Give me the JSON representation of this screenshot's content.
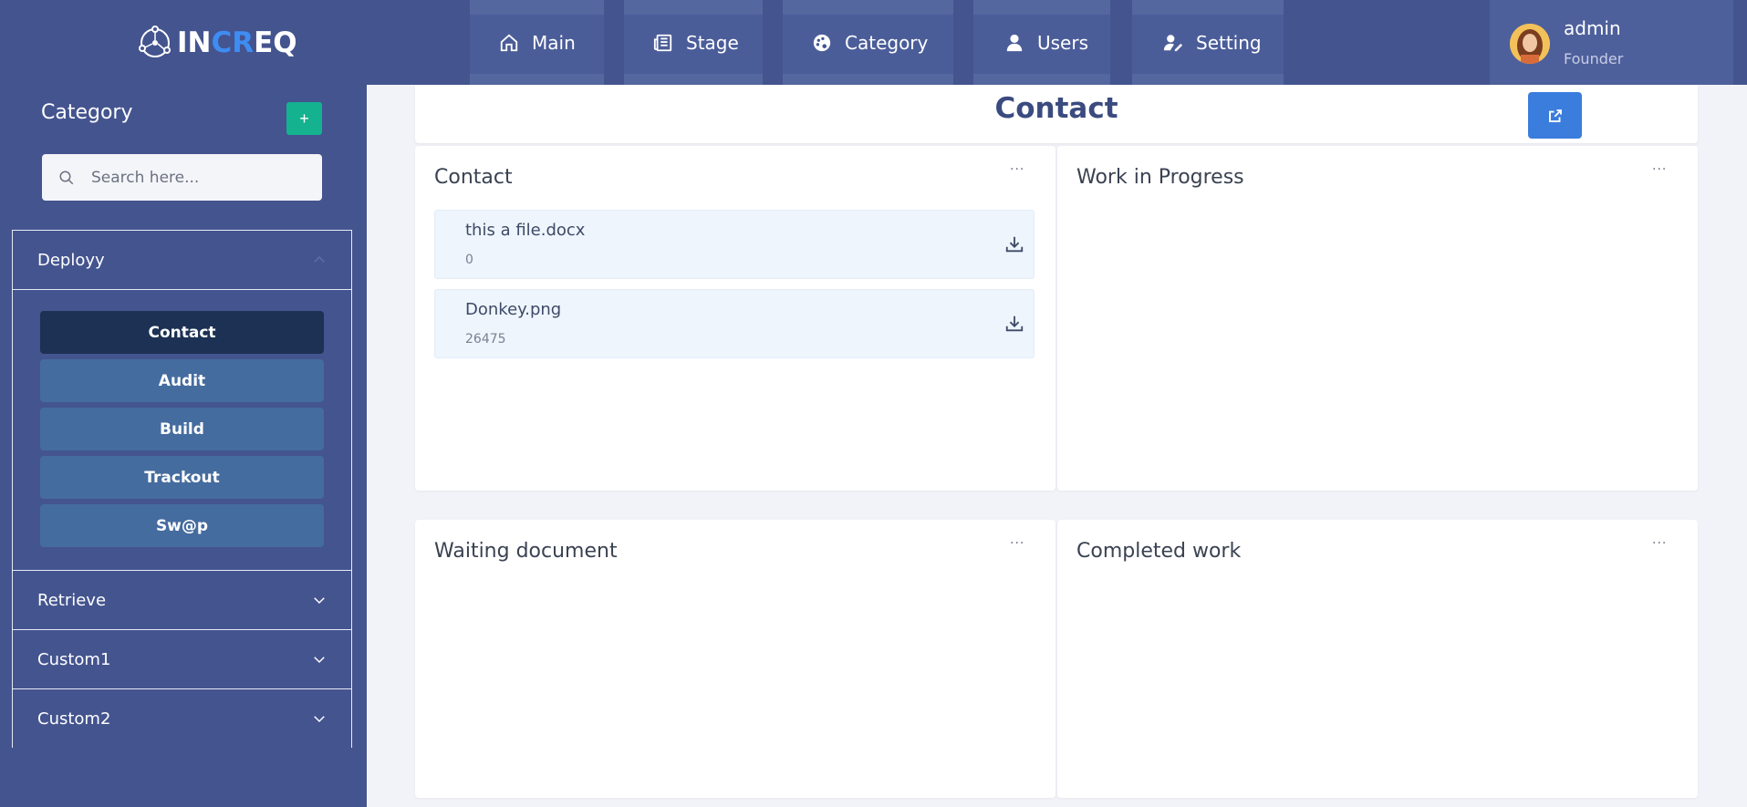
{
  "brand": {
    "name_prefix": "IN",
    "name_accent": "CR",
    "name_suffix": "EQ"
  },
  "nav": {
    "items": [
      {
        "label": "Main",
        "icon": "home-icon"
      },
      {
        "label": "Stage",
        "icon": "newspaper-icon"
      },
      {
        "label": "Category",
        "icon": "palette-icon"
      },
      {
        "label": "Users",
        "icon": "user-icon"
      },
      {
        "label": "Setting",
        "icon": "user-edit-icon"
      }
    ]
  },
  "user": {
    "name": "admin",
    "role": "Founder"
  },
  "sidebar": {
    "title": "Category",
    "add_label": "+",
    "search_placeholder": "Search here...",
    "sections": [
      {
        "label": "Deployy",
        "expanded": true,
        "items": [
          {
            "label": "Contact",
            "active": true
          },
          {
            "label": "Audit",
            "active": false
          },
          {
            "label": "Build",
            "active": false
          },
          {
            "label": "Trackout",
            "active": false
          },
          {
            "label": "Sw@p",
            "active": false
          }
        ]
      },
      {
        "label": "Retrieve",
        "expanded": false
      },
      {
        "label": "Custom1",
        "expanded": false
      },
      {
        "label": "Custom2",
        "expanded": false
      }
    ]
  },
  "main": {
    "title": "Contact",
    "cards": [
      {
        "title": "Contact",
        "files": [
          {
            "name": "this a file.docx",
            "size": "0"
          },
          {
            "name": "Donkey.png",
            "size": "26475"
          }
        ]
      },
      {
        "title": "Work in Progress",
        "files": []
      },
      {
        "title": "Waiting document",
        "files": []
      },
      {
        "title": "Completed work",
        "files": []
      }
    ],
    "menu_label": "···"
  },
  "colors": {
    "header_bg": "#44548f",
    "accent_blue": "#3b7ddd",
    "add_green": "#14b28f",
    "active_item": "#1c3153",
    "item_bg": "#456c9f"
  }
}
